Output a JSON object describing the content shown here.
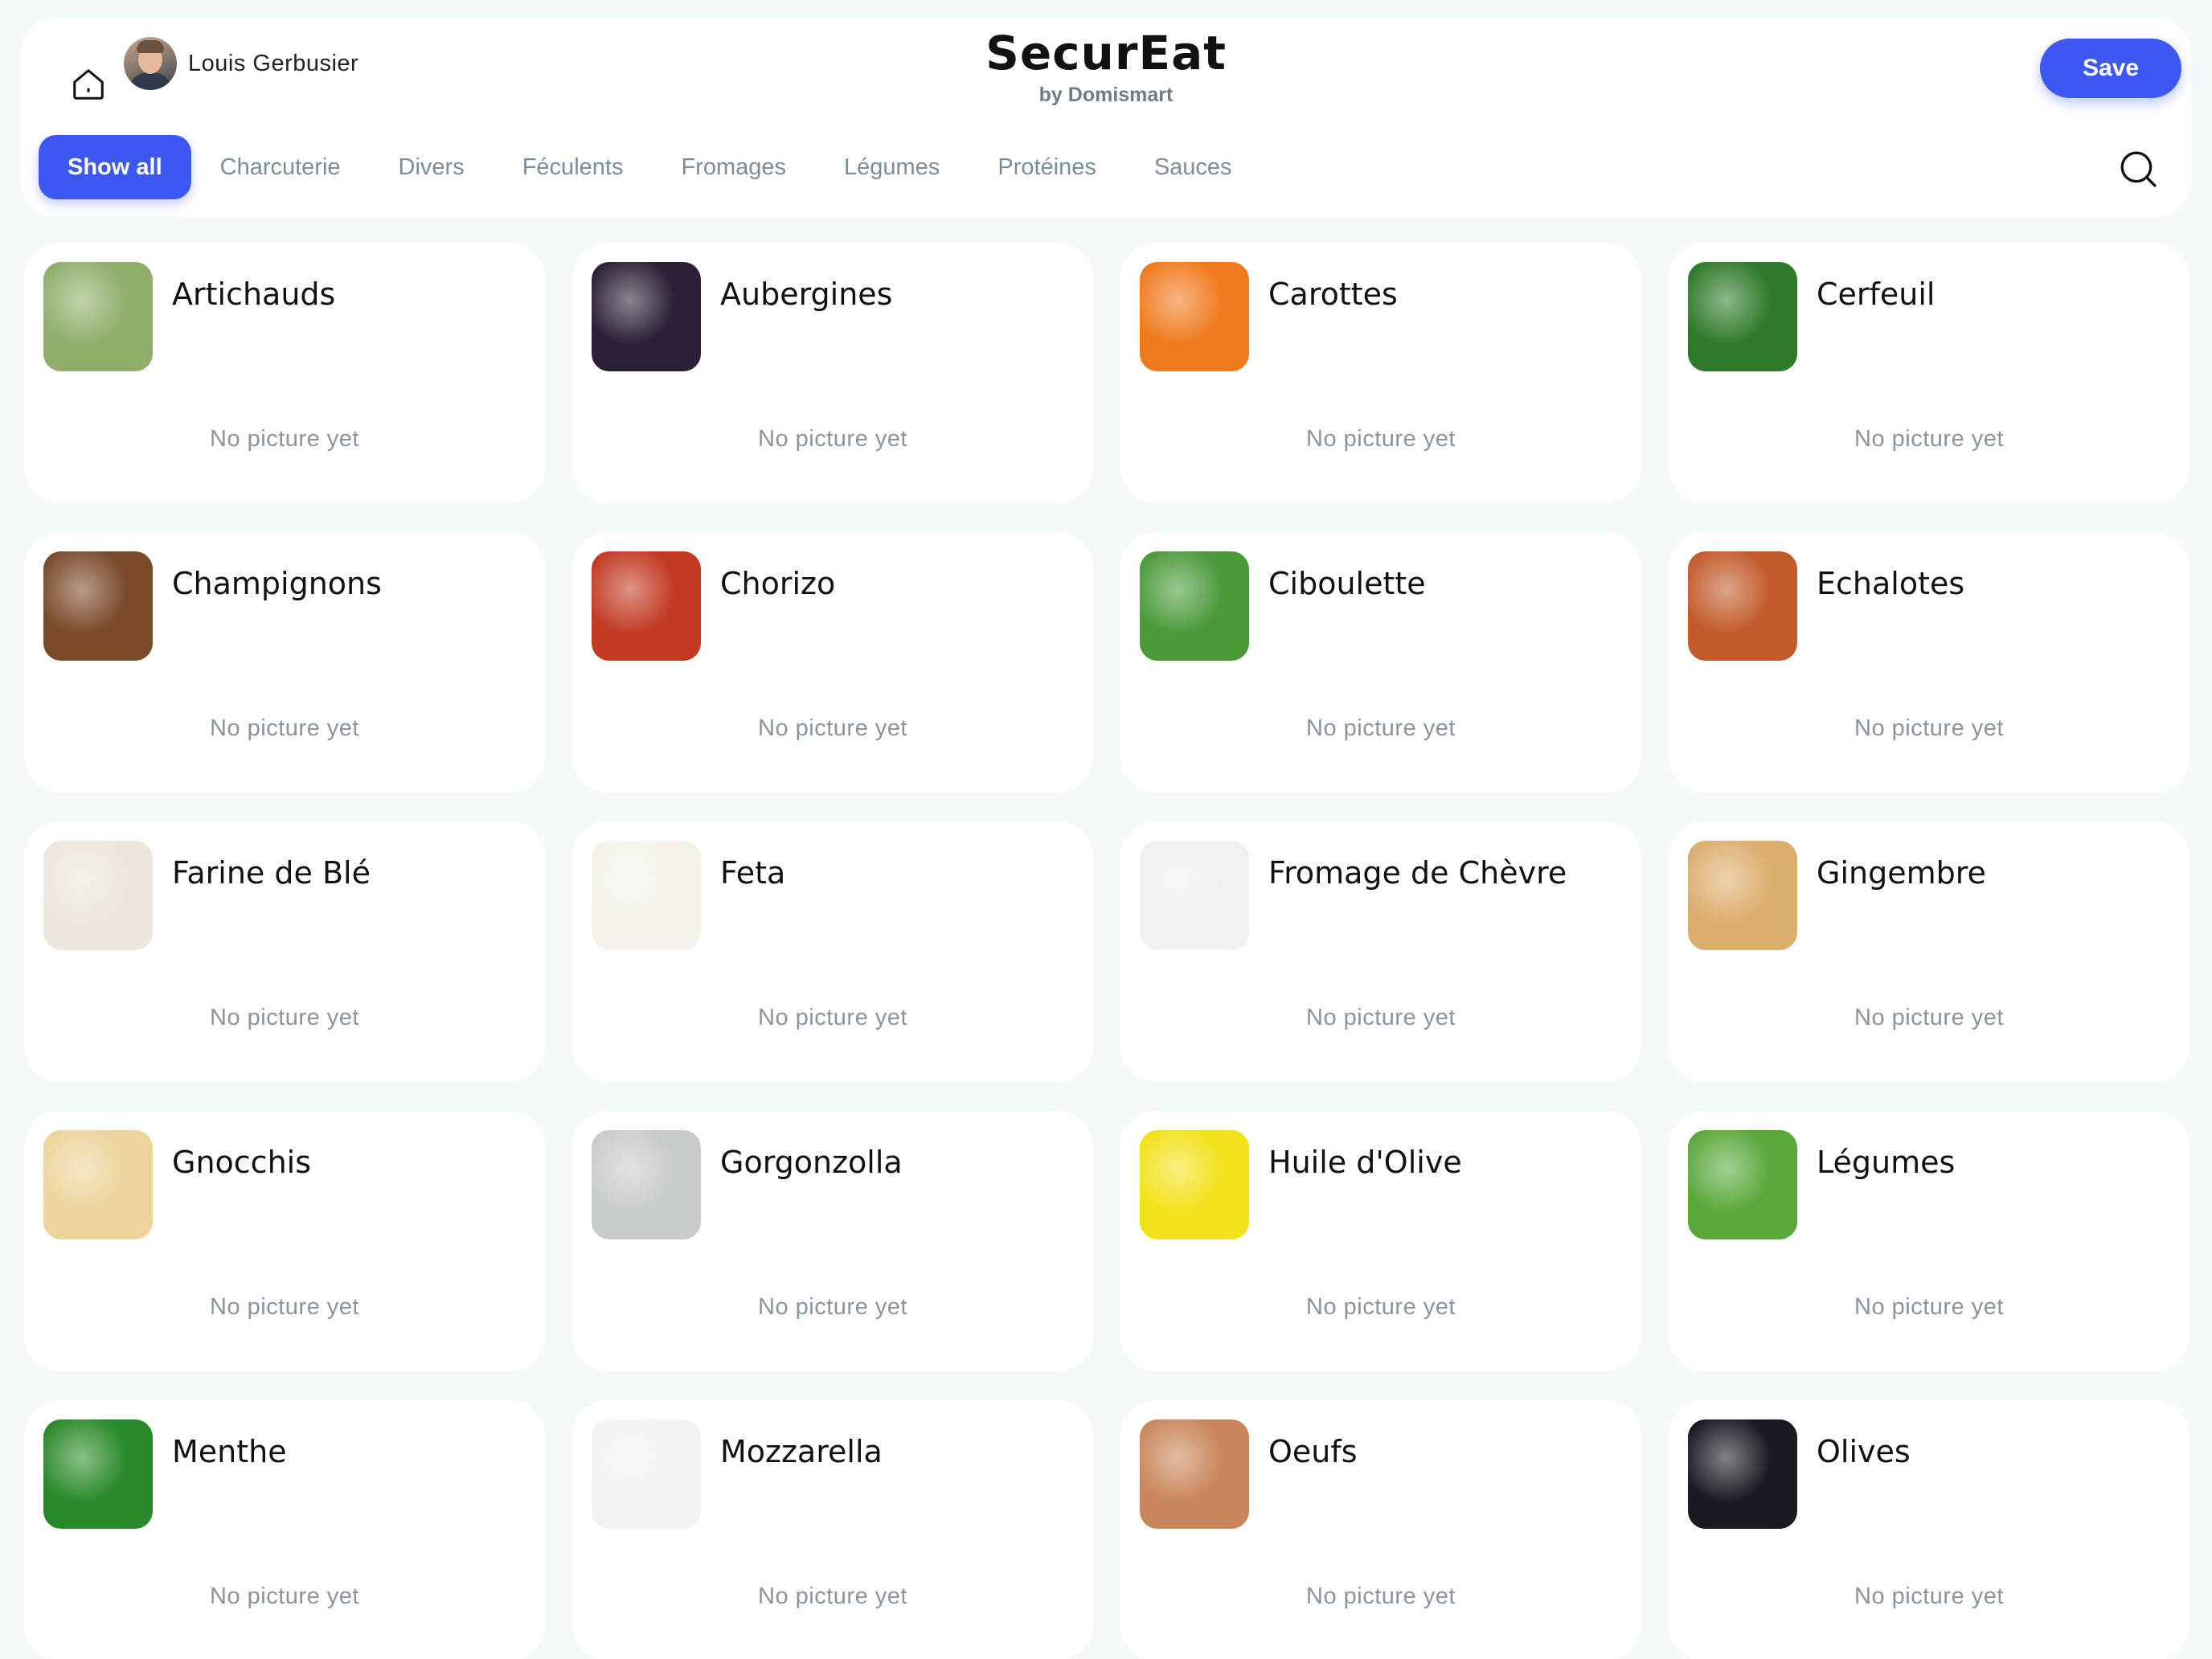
{
  "header": {
    "user_name": "Louis Gerbusier",
    "brand_title": "SecurEat",
    "brand_subtitle": "by Domismart",
    "save_label": "Save",
    "accent_color": "#3d57f2"
  },
  "tabs": [
    {
      "label": "Show all",
      "active": true
    },
    {
      "label": "Charcuterie",
      "active": false
    },
    {
      "label": "Divers",
      "active": false
    },
    {
      "label": "Féculents",
      "active": false
    },
    {
      "label": "Fromages",
      "active": false
    },
    {
      "label": "Légumes",
      "active": false
    },
    {
      "label": "Protéines",
      "active": false
    },
    {
      "label": "Sauces",
      "active": false
    }
  ],
  "items": [
    {
      "name": "Artichauds",
      "status": "No picture yet",
      "color": "#8fae6a"
    },
    {
      "name": "Aubergines",
      "status": "No picture yet",
      "color": "#2a1f35"
    },
    {
      "name": "Carottes",
      "status": "No picture yet",
      "color": "#f07a1e"
    },
    {
      "name": "Cerfeuil",
      "status": "No picture yet",
      "color": "#2f7a2a"
    },
    {
      "name": "Champignons",
      "status": "No picture yet",
      "color": "#7a4a2a"
    },
    {
      "name": "Chorizo",
      "status": "No picture yet",
      "color": "#c23a22"
    },
    {
      "name": "Ciboulette",
      "status": "No picture yet",
      "color": "#4a9a3a"
    },
    {
      "name": "Echalotes",
      "status": "No picture yet",
      "color": "#c25a2a"
    },
    {
      "name": "Farine de Blé",
      "status": "No picture yet",
      "color": "#ece6dc"
    },
    {
      "name": "Feta",
      "status": "No picture yet",
      "color": "#f4f2ea"
    },
    {
      "name": "Fromage de Chèvre",
      "status": "No picture yet",
      "color": "#eef0f2"
    },
    {
      "name": "Gingembre",
      "status": "No picture yet",
      "color": "#dcae6e"
    },
    {
      "name": "Gnocchis",
      "status": "No picture yet",
      "color": "#ecd49a"
    },
    {
      "name": "Gorgonzolla",
      "status": "No picture yet",
      "color": "#c8ccc8"
    },
    {
      "name": "Huile d'Olive",
      "status": "No picture yet",
      "color": "#f2e21a"
    },
    {
      "name": "Légumes",
      "status": "No picture yet",
      "color": "#5aa83a"
    },
    {
      "name": "Menthe",
      "status": "No picture yet",
      "color": "#2a8a2a"
    },
    {
      "name": "Mozzarella",
      "status": "No picture yet",
      "color": "#f2f2f0"
    },
    {
      "name": "Oeufs",
      "status": "No picture yet",
      "color": "#c8865a"
    },
    {
      "name": "Olives",
      "status": "No picture yet",
      "color": "#1a1a22"
    }
  ]
}
